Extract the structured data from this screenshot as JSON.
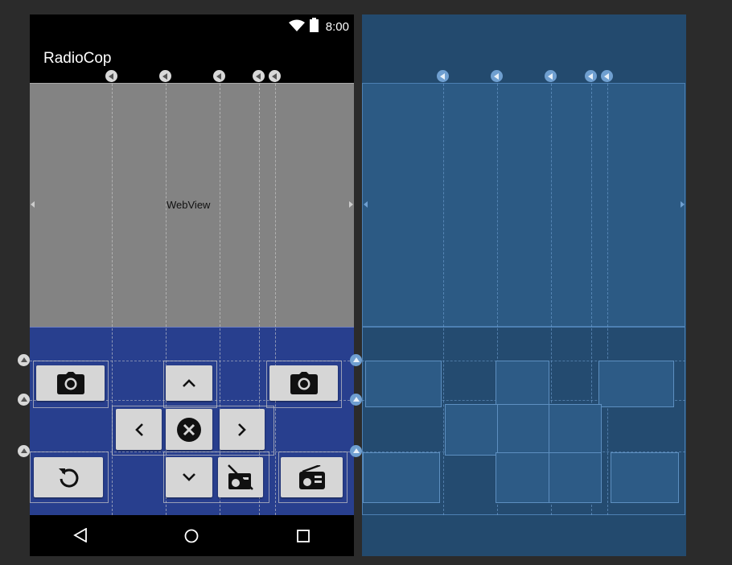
{
  "status_bar": {
    "time": "8:00",
    "wifi_icon": "wifi-icon",
    "battery_icon": "battery-icon"
  },
  "app_bar": {
    "title": "RadioCop"
  },
  "webview": {
    "label": "WebView"
  },
  "controls": {
    "camera_left": "camera-icon",
    "arrow_up": "chevron-up-icon",
    "camera_right": "camera-icon",
    "arrow_left": "chevron-left-icon",
    "stop": "close-circle-icon",
    "arrow_right": "chevron-right-icon",
    "refresh": "refresh-icon",
    "arrow_down": "chevron-down-icon",
    "radio_off": "radio-off-icon",
    "radio": "radio-icon"
  },
  "nav_bar": {
    "back": "back-icon",
    "home": "home-icon",
    "recents": "recents-icon"
  },
  "colors": {
    "panel": "#283f8e",
    "webview": "#838383",
    "blueprint_bg": "#234a6e",
    "blueprint_box": "#2d5b86",
    "button": "#d6d6d6"
  }
}
